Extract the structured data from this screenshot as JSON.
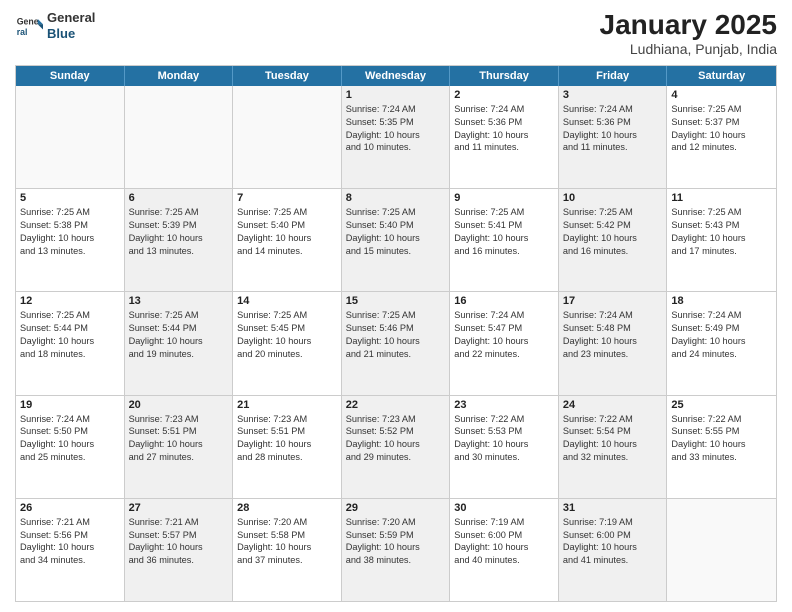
{
  "header": {
    "logo_general": "General",
    "logo_blue": "Blue",
    "title": "January 2025",
    "subtitle": "Ludhiana, Punjab, India"
  },
  "days_of_week": [
    "Sunday",
    "Monday",
    "Tuesday",
    "Wednesday",
    "Thursday",
    "Friday",
    "Saturday"
  ],
  "weeks": [
    [
      {
        "day": "",
        "lines": [],
        "empty": true
      },
      {
        "day": "",
        "lines": [],
        "empty": true
      },
      {
        "day": "",
        "lines": [],
        "empty": true
      },
      {
        "day": "1",
        "lines": [
          "Sunrise: 7:24 AM",
          "Sunset: 5:35 PM",
          "Daylight: 10 hours",
          "and 10 minutes."
        ],
        "empty": false,
        "shaded": true
      },
      {
        "day": "2",
        "lines": [
          "Sunrise: 7:24 AM",
          "Sunset: 5:36 PM",
          "Daylight: 10 hours",
          "and 11 minutes."
        ],
        "empty": false
      },
      {
        "day": "3",
        "lines": [
          "Sunrise: 7:24 AM",
          "Sunset: 5:36 PM",
          "Daylight: 10 hours",
          "and 11 minutes."
        ],
        "empty": false,
        "shaded": true
      },
      {
        "day": "4",
        "lines": [
          "Sunrise: 7:25 AM",
          "Sunset: 5:37 PM",
          "Daylight: 10 hours",
          "and 12 minutes."
        ],
        "empty": false
      }
    ],
    [
      {
        "day": "5",
        "lines": [
          "Sunrise: 7:25 AM",
          "Sunset: 5:38 PM",
          "Daylight: 10 hours",
          "and 13 minutes."
        ],
        "empty": false
      },
      {
        "day": "6",
        "lines": [
          "Sunrise: 7:25 AM",
          "Sunset: 5:39 PM",
          "Daylight: 10 hours",
          "and 13 minutes."
        ],
        "empty": false,
        "shaded": true
      },
      {
        "day": "7",
        "lines": [
          "Sunrise: 7:25 AM",
          "Sunset: 5:40 PM",
          "Daylight: 10 hours",
          "and 14 minutes."
        ],
        "empty": false
      },
      {
        "day": "8",
        "lines": [
          "Sunrise: 7:25 AM",
          "Sunset: 5:40 PM",
          "Daylight: 10 hours",
          "and 15 minutes."
        ],
        "empty": false,
        "shaded": true
      },
      {
        "day": "9",
        "lines": [
          "Sunrise: 7:25 AM",
          "Sunset: 5:41 PM",
          "Daylight: 10 hours",
          "and 16 minutes."
        ],
        "empty": false
      },
      {
        "day": "10",
        "lines": [
          "Sunrise: 7:25 AM",
          "Sunset: 5:42 PM",
          "Daylight: 10 hours",
          "and 16 minutes."
        ],
        "empty": false,
        "shaded": true
      },
      {
        "day": "11",
        "lines": [
          "Sunrise: 7:25 AM",
          "Sunset: 5:43 PM",
          "Daylight: 10 hours",
          "and 17 minutes."
        ],
        "empty": false
      }
    ],
    [
      {
        "day": "12",
        "lines": [
          "Sunrise: 7:25 AM",
          "Sunset: 5:44 PM",
          "Daylight: 10 hours",
          "and 18 minutes."
        ],
        "empty": false
      },
      {
        "day": "13",
        "lines": [
          "Sunrise: 7:25 AM",
          "Sunset: 5:44 PM",
          "Daylight: 10 hours",
          "and 19 minutes."
        ],
        "empty": false,
        "shaded": true
      },
      {
        "day": "14",
        "lines": [
          "Sunrise: 7:25 AM",
          "Sunset: 5:45 PM",
          "Daylight: 10 hours",
          "and 20 minutes."
        ],
        "empty": false
      },
      {
        "day": "15",
        "lines": [
          "Sunrise: 7:25 AM",
          "Sunset: 5:46 PM",
          "Daylight: 10 hours",
          "and 21 minutes."
        ],
        "empty": false,
        "shaded": true
      },
      {
        "day": "16",
        "lines": [
          "Sunrise: 7:24 AM",
          "Sunset: 5:47 PM",
          "Daylight: 10 hours",
          "and 22 minutes."
        ],
        "empty": false
      },
      {
        "day": "17",
        "lines": [
          "Sunrise: 7:24 AM",
          "Sunset: 5:48 PM",
          "Daylight: 10 hours",
          "and 23 minutes."
        ],
        "empty": false,
        "shaded": true
      },
      {
        "day": "18",
        "lines": [
          "Sunrise: 7:24 AM",
          "Sunset: 5:49 PM",
          "Daylight: 10 hours",
          "and 24 minutes."
        ],
        "empty": false
      }
    ],
    [
      {
        "day": "19",
        "lines": [
          "Sunrise: 7:24 AM",
          "Sunset: 5:50 PM",
          "Daylight: 10 hours",
          "and 25 minutes."
        ],
        "empty": false
      },
      {
        "day": "20",
        "lines": [
          "Sunrise: 7:23 AM",
          "Sunset: 5:51 PM",
          "Daylight: 10 hours",
          "and 27 minutes."
        ],
        "empty": false,
        "shaded": true
      },
      {
        "day": "21",
        "lines": [
          "Sunrise: 7:23 AM",
          "Sunset: 5:51 PM",
          "Daylight: 10 hours",
          "and 28 minutes."
        ],
        "empty": false
      },
      {
        "day": "22",
        "lines": [
          "Sunrise: 7:23 AM",
          "Sunset: 5:52 PM",
          "Daylight: 10 hours",
          "and 29 minutes."
        ],
        "empty": false,
        "shaded": true
      },
      {
        "day": "23",
        "lines": [
          "Sunrise: 7:22 AM",
          "Sunset: 5:53 PM",
          "Daylight: 10 hours",
          "and 30 minutes."
        ],
        "empty": false
      },
      {
        "day": "24",
        "lines": [
          "Sunrise: 7:22 AM",
          "Sunset: 5:54 PM",
          "Daylight: 10 hours",
          "and 32 minutes."
        ],
        "empty": false,
        "shaded": true
      },
      {
        "day": "25",
        "lines": [
          "Sunrise: 7:22 AM",
          "Sunset: 5:55 PM",
          "Daylight: 10 hours",
          "and 33 minutes."
        ],
        "empty": false
      }
    ],
    [
      {
        "day": "26",
        "lines": [
          "Sunrise: 7:21 AM",
          "Sunset: 5:56 PM",
          "Daylight: 10 hours",
          "and 34 minutes."
        ],
        "empty": false
      },
      {
        "day": "27",
        "lines": [
          "Sunrise: 7:21 AM",
          "Sunset: 5:57 PM",
          "Daylight: 10 hours",
          "and 36 minutes."
        ],
        "empty": false,
        "shaded": true
      },
      {
        "day": "28",
        "lines": [
          "Sunrise: 7:20 AM",
          "Sunset: 5:58 PM",
          "Daylight: 10 hours",
          "and 37 minutes."
        ],
        "empty": false
      },
      {
        "day": "29",
        "lines": [
          "Sunrise: 7:20 AM",
          "Sunset: 5:59 PM",
          "Daylight: 10 hours",
          "and 38 minutes."
        ],
        "empty": false,
        "shaded": true
      },
      {
        "day": "30",
        "lines": [
          "Sunrise: 7:19 AM",
          "Sunset: 6:00 PM",
          "Daylight: 10 hours",
          "and 40 minutes."
        ],
        "empty": false
      },
      {
        "day": "31",
        "lines": [
          "Sunrise: 7:19 AM",
          "Sunset: 6:00 PM",
          "Daylight: 10 hours",
          "and 41 minutes."
        ],
        "empty": false,
        "shaded": true
      },
      {
        "day": "",
        "lines": [],
        "empty": true
      }
    ]
  ]
}
